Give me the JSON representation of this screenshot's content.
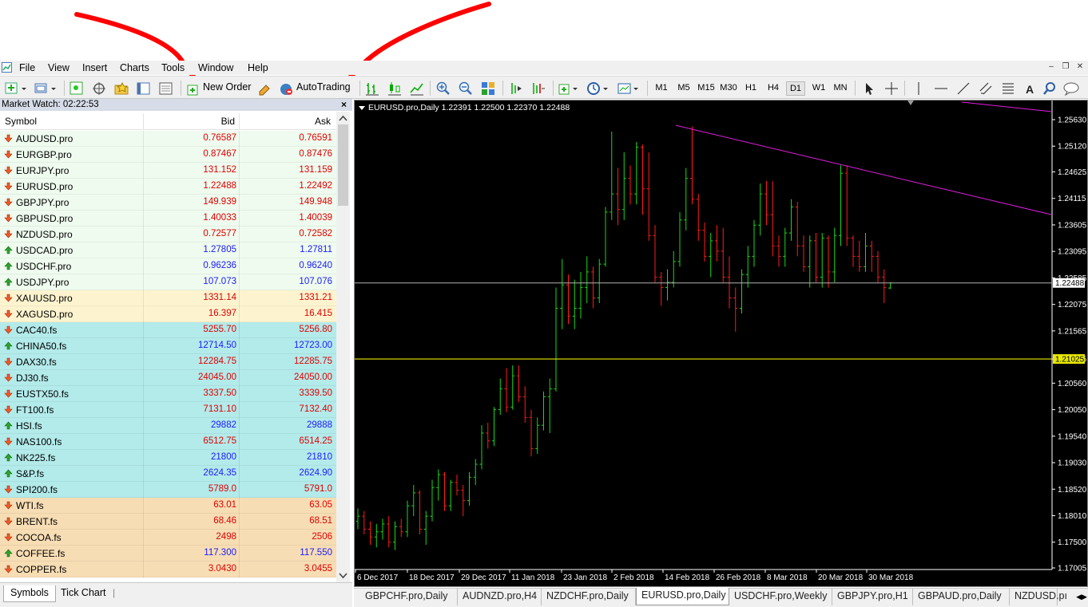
{
  "window": {
    "controls": [
      "–",
      "❐",
      "✕"
    ]
  },
  "menu": [
    "File",
    "View",
    "Insert",
    "Charts",
    "Tools",
    "Window",
    "Help"
  ],
  "toolbar": {
    "new_order": "New Order",
    "auto_trading": "AutoTrading",
    "timeframes": [
      "M1",
      "M5",
      "M15",
      "M30",
      "H1",
      "H4",
      "D1",
      "W1",
      "MN"
    ],
    "active_timeframe": "D1"
  },
  "market_watch": {
    "title": "Market Watch: 02:22:53",
    "close": "×",
    "columns": {
      "symbol": "Symbol",
      "bid": "Bid",
      "ask": "Ask"
    },
    "rows": [
      {
        "symbol": "AUDUSD.pro",
        "bid": "0.76587",
        "ask": "0.76591",
        "dir": "down",
        "group": "fx"
      },
      {
        "symbol": "EURGBP.pro",
        "bid": "0.87467",
        "ask": "0.87476",
        "dir": "down",
        "group": "fx"
      },
      {
        "symbol": "EURJPY.pro",
        "bid": "131.152",
        "ask": "131.159",
        "dir": "down",
        "group": "fx"
      },
      {
        "symbol": "EURUSD.pro",
        "bid": "1.22488",
        "ask": "1.22492",
        "dir": "down",
        "group": "fx"
      },
      {
        "symbol": "GBPJPY.pro",
        "bid": "149.939",
        "ask": "149.948",
        "dir": "down",
        "group": "fx"
      },
      {
        "symbol": "GBPUSD.pro",
        "bid": "1.40033",
        "ask": "1.40039",
        "dir": "down",
        "group": "fx"
      },
      {
        "symbol": "NZDUSD.pro",
        "bid": "0.72577",
        "ask": "0.72582",
        "dir": "down",
        "group": "fx"
      },
      {
        "symbol": "USDCAD.pro",
        "bid": "1.27805",
        "ask": "1.27811",
        "dir": "up",
        "group": "fx"
      },
      {
        "symbol": "USDCHF.pro",
        "bid": "0.96236",
        "ask": "0.96240",
        "dir": "up",
        "group": "fx"
      },
      {
        "symbol": "USDJPY.pro",
        "bid": "107.073",
        "ask": "107.076",
        "dir": "up",
        "group": "fx"
      },
      {
        "symbol": "XAUUSD.pro",
        "bid": "1331.14",
        "ask": "1331.21",
        "dir": "down",
        "group": "metal"
      },
      {
        "symbol": "XAGUSD.pro",
        "bid": "16.397",
        "ask": "16.415",
        "dir": "down",
        "group": "metal"
      },
      {
        "symbol": "CAC40.fs",
        "bid": "5255.70",
        "ask": "5256.80",
        "dir": "down",
        "group": "index"
      },
      {
        "symbol": "CHINA50.fs",
        "bid": "12714.50",
        "ask": "12723.00",
        "dir": "up",
        "group": "index"
      },
      {
        "symbol": "DAX30.fs",
        "bid": "12284.75",
        "ask": "12285.75",
        "dir": "down",
        "group": "index"
      },
      {
        "symbol": "DJ30.fs",
        "bid": "24045.00",
        "ask": "24050.00",
        "dir": "down",
        "group": "index"
      },
      {
        "symbol": "EUSTX50.fs",
        "bid": "3337.50",
        "ask": "3339.50",
        "dir": "down",
        "group": "index"
      },
      {
        "symbol": "FT100.fs",
        "bid": "7131.10",
        "ask": "7132.40",
        "dir": "down",
        "group": "index"
      },
      {
        "symbol": "HSI.fs",
        "bid": "29882",
        "ask": "29888",
        "dir": "up",
        "group": "index"
      },
      {
        "symbol": "NAS100.fs",
        "bid": "6512.75",
        "ask": "6514.25",
        "dir": "down",
        "group": "index"
      },
      {
        "symbol": "NK225.fs",
        "bid": "21800",
        "ask": "21810",
        "dir": "up",
        "group": "index"
      },
      {
        "symbol": "S&P.fs",
        "bid": "2624.35",
        "ask": "2624.90",
        "dir": "up",
        "group": "index"
      },
      {
        "symbol": "SPI200.fs",
        "bid": "5789.0",
        "ask": "5791.0",
        "dir": "down",
        "group": "index"
      },
      {
        "symbol": "WTI.fs",
        "bid": "63.01",
        "ask": "63.05",
        "dir": "down",
        "group": "commodity"
      },
      {
        "symbol": "BRENT.fs",
        "bid": "68.46",
        "ask": "68.51",
        "dir": "down",
        "group": "commodity"
      },
      {
        "symbol": "COCOA.fs",
        "bid": "2498",
        "ask": "2506",
        "dir": "down",
        "group": "commodity"
      },
      {
        "symbol": "COFFEE.fs",
        "bid": "117.300",
        "ask": "117.550",
        "dir": "up",
        "group": "commodity"
      },
      {
        "symbol": "COPPER.fs",
        "bid": "3.0430",
        "ask": "3.0455",
        "dir": "down",
        "group": "commodity"
      }
    ],
    "tabs": [
      "Symbols",
      "Tick Chart"
    ],
    "active_tab": "Symbols"
  },
  "colors": {
    "fx": "#eefbee",
    "metal": "#fdf4cf",
    "index": "#b3eaea",
    "commodity": "#f7ddb4",
    "bull": "#19d919",
    "bear": "#ff1a1a",
    "trendline": "#e01ee0",
    "hline": "#e8e800",
    "bidline": "#b3b3b3",
    "annotation": "#ff0000"
  },
  "chart": {
    "title": "EURUSD.pro,Daily  1.22391 1.22500 1.22370 1.22488",
    "price_labels": [
      "1.25630",
      "1.25120",
      "1.24625",
      "1.24115",
      "1.23605",
      "1.23095",
      "1.22585",
      "1.22075",
      "1.21565",
      "1.21025",
      "1.20560",
      "1.20050",
      "1.19540",
      "1.19030",
      "1.18520",
      "1.18010",
      "1.17500",
      "1.17005"
    ],
    "current_price_label": "1.22488",
    "hline_label": "1.21025",
    "date_labels": [
      "6 Dec 2017",
      "18 Dec 2017",
      "29 Dec 2017",
      "11 Jan 2018",
      "23 Jan 2018",
      "2 Feb 2018",
      "14 Feb 2018",
      "26 Feb 2018",
      "8 Mar 2018",
      "20 Mar 2018",
      "30 Mar 2018"
    ]
  },
  "chart_tabs": [
    "GBPCHF.pro,Daily",
    "AUDNZD.pro,H4",
    "NZDCHF.pro,Daily",
    "EURUSD.pro,Daily",
    "USDCHF.pro,Weekly",
    "GBPJPY.pro,H1",
    "GBPAUD.pro,Daily",
    "NZDUSD.pı"
  ],
  "active_chart_tab": "EURUSD.pro,Daily"
}
